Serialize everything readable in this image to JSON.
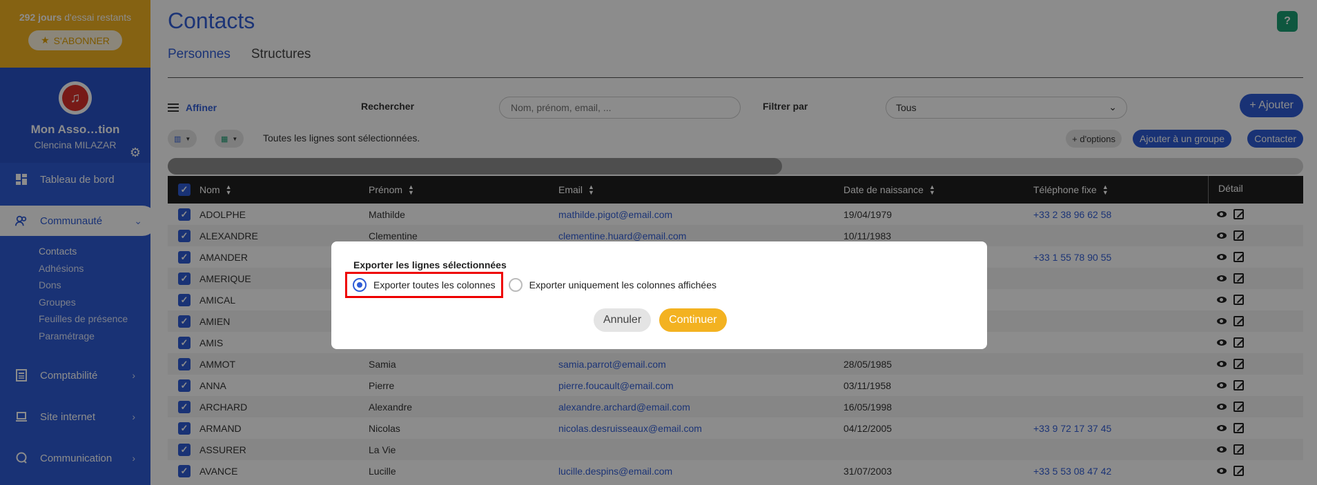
{
  "sidebar": {
    "trial_days": "292 jours",
    "trial_rest": " d'essai restants",
    "subscribe_label": "S'ABONNER",
    "org_name": "Mon Asso…tion",
    "user_name": "Clencina MILAZAR",
    "nav": [
      {
        "label": "Tableau de bord",
        "icon": "dashboard-icon"
      },
      {
        "label": "Communauté",
        "icon": "community-icon"
      },
      {
        "label": "Comptabilité",
        "icon": "calculator-icon"
      },
      {
        "label": "Site internet",
        "icon": "laptop-icon"
      },
      {
        "label": "Communication",
        "icon": "chat-icon"
      }
    ],
    "subnav": [
      "Contacts",
      "Adhésions",
      "Dons",
      "Groupes",
      "Feuilles de présence",
      "Paramétrage"
    ]
  },
  "header": {
    "title": "Contacts",
    "help": "?",
    "tabs": [
      "Personnes",
      "Structures"
    ]
  },
  "toolbar": {
    "affiner": "Affiner",
    "rechercher": "Rechercher",
    "search_placeholder": "Nom, prénom, email, ...",
    "filtrer": "Filtrer par",
    "filter_value": "Tous",
    "add": "+ Ajouter",
    "selection_text": "Toutes les lignes sont sélectionnées.",
    "options": "+ d'options",
    "add_group": "Ajouter à un groupe",
    "contact": "Contacter"
  },
  "table": {
    "columns": [
      "Nom",
      "Prénom",
      "Email",
      "Date de naissance",
      "Téléphone fixe",
      "Détail"
    ],
    "rows": [
      [
        "ADOLPHE",
        "Mathilde",
        "mathilde.pigot@email.com",
        "19/04/1979",
        "+33 2 38 96 62 58"
      ],
      [
        "ALEXANDRE",
        "Clementine",
        "clementine.huard@email.com",
        "10/11/1983",
        ""
      ],
      [
        "AMANDER",
        "",
        "",
        "",
        "+33 1 55 78 90 55"
      ],
      [
        "AMERIQUE",
        "",
        "",
        "",
        ""
      ],
      [
        "AMICAL",
        "",
        "",
        "",
        ""
      ],
      [
        "AMIEN",
        "",
        "",
        "",
        ""
      ],
      [
        "AMIS",
        "",
        "",
        "",
        ""
      ],
      [
        "AMMOT",
        "Samia",
        "samia.parrot@email.com",
        "28/05/1985",
        ""
      ],
      [
        "ANNA",
        "Pierre",
        "pierre.foucault@email.com",
        "03/11/1958",
        ""
      ],
      [
        "ARCHARD",
        "Alexandre",
        "alexandre.archard@email.com",
        "16/05/1998",
        ""
      ],
      [
        "ARMAND",
        "Nicolas",
        "nicolas.desruisseaux@email.com",
        "04/12/2005",
        "+33 9 72 17 37 45"
      ],
      [
        "ASSURER",
        "La Vie",
        "",
        "",
        ""
      ],
      [
        "AVANCE",
        "Lucille",
        "lucille.despins@email.com",
        "31/07/2003",
        "+33 5 53 08 47 42"
      ]
    ]
  },
  "modal": {
    "title": "Exporter les lignes sélectionnées",
    "option_all": "Exporter toutes les colonnes",
    "option_displayed": "Exporter uniquement les colonnes affichées",
    "cancel": "Annuler",
    "continue": "Continuer"
  }
}
